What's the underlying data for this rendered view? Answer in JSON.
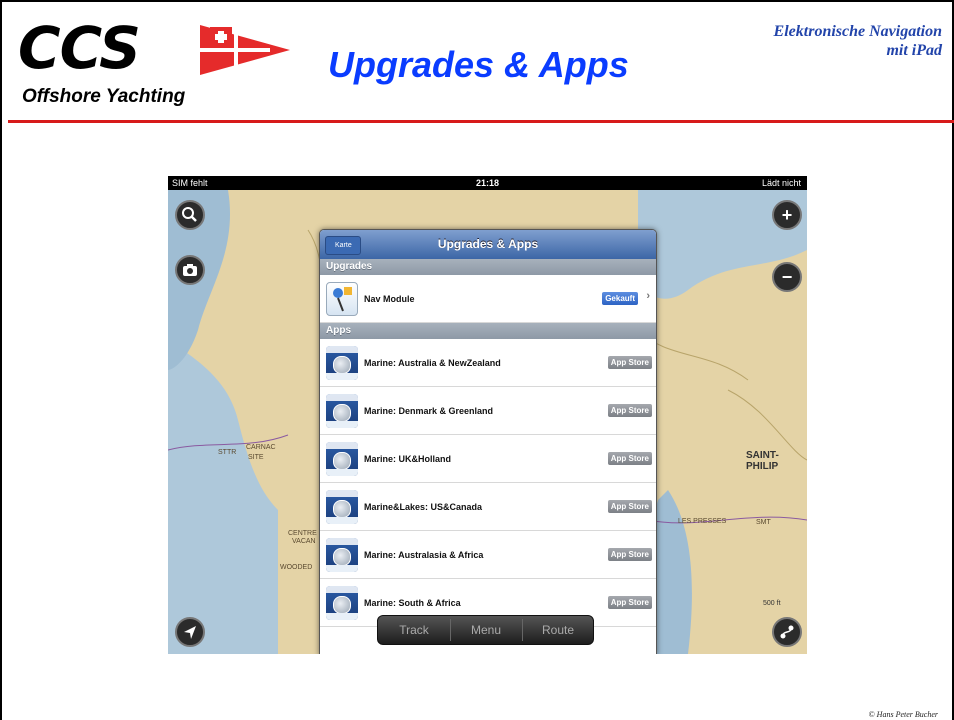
{
  "header": {
    "logo": "CCS",
    "logo_subtitle": "Offshore Yachting",
    "title": "Upgrades & Apps",
    "right_line1": "Elektronische Navigation",
    "right_line2": "mit iPad"
  },
  "colors": {
    "title_blue": "#0a3cff",
    "rule_red": "#d71a1a",
    "nav_bar_blue": "#3c66a6"
  },
  "ipad": {
    "status": {
      "carrier": "SIM fehlt",
      "time": "21:18",
      "battery": "Lädt nicht"
    },
    "map_labels": {
      "carnac": "CARNAC",
      "carnac_sub": "SITE",
      "sttr": "STTR",
      "saint_phil": "SAINT-PHILIP",
      "centre": "CENTRE",
      "vacan": "VACAN",
      "wooded": "WOODED",
      "les_presses": "LES PRESSES",
      "smt": "SMT",
      "scale": "500 ft"
    },
    "map_buttons": {
      "search": "search-icon",
      "camera": "camera-icon",
      "zoom_in": "+",
      "zoom_out": "−",
      "locate": "location-arrow-icon",
      "tools": "route-tools-icon"
    },
    "popup": {
      "back_button": "Karte",
      "title": "Upgrades & Apps",
      "upgrades_header": "Upgrades",
      "upgrades": [
        {
          "label": "Nav Module",
          "badge": "Gekauft"
        }
      ],
      "apps_header": "Apps",
      "apps": [
        {
          "label": "Marine: Australia & NewZealand",
          "badge": "App Store"
        },
        {
          "label": "Marine: Denmark & Greenland",
          "badge": "App Store"
        },
        {
          "label": "Marine: UK&Holland",
          "badge": "App Store"
        },
        {
          "label": "Marine&Lakes: US&Canada",
          "badge": "App Store"
        },
        {
          "label": "Marine: Australasia & Africa",
          "badge": "App Store"
        },
        {
          "label": "Marine: South & Africa",
          "badge": "App Store"
        }
      ]
    },
    "toolbar": {
      "track": "Track",
      "menu": "Menu",
      "route": "Route"
    }
  },
  "footer": {
    "copyright": "© Hans Peter Bucher"
  }
}
